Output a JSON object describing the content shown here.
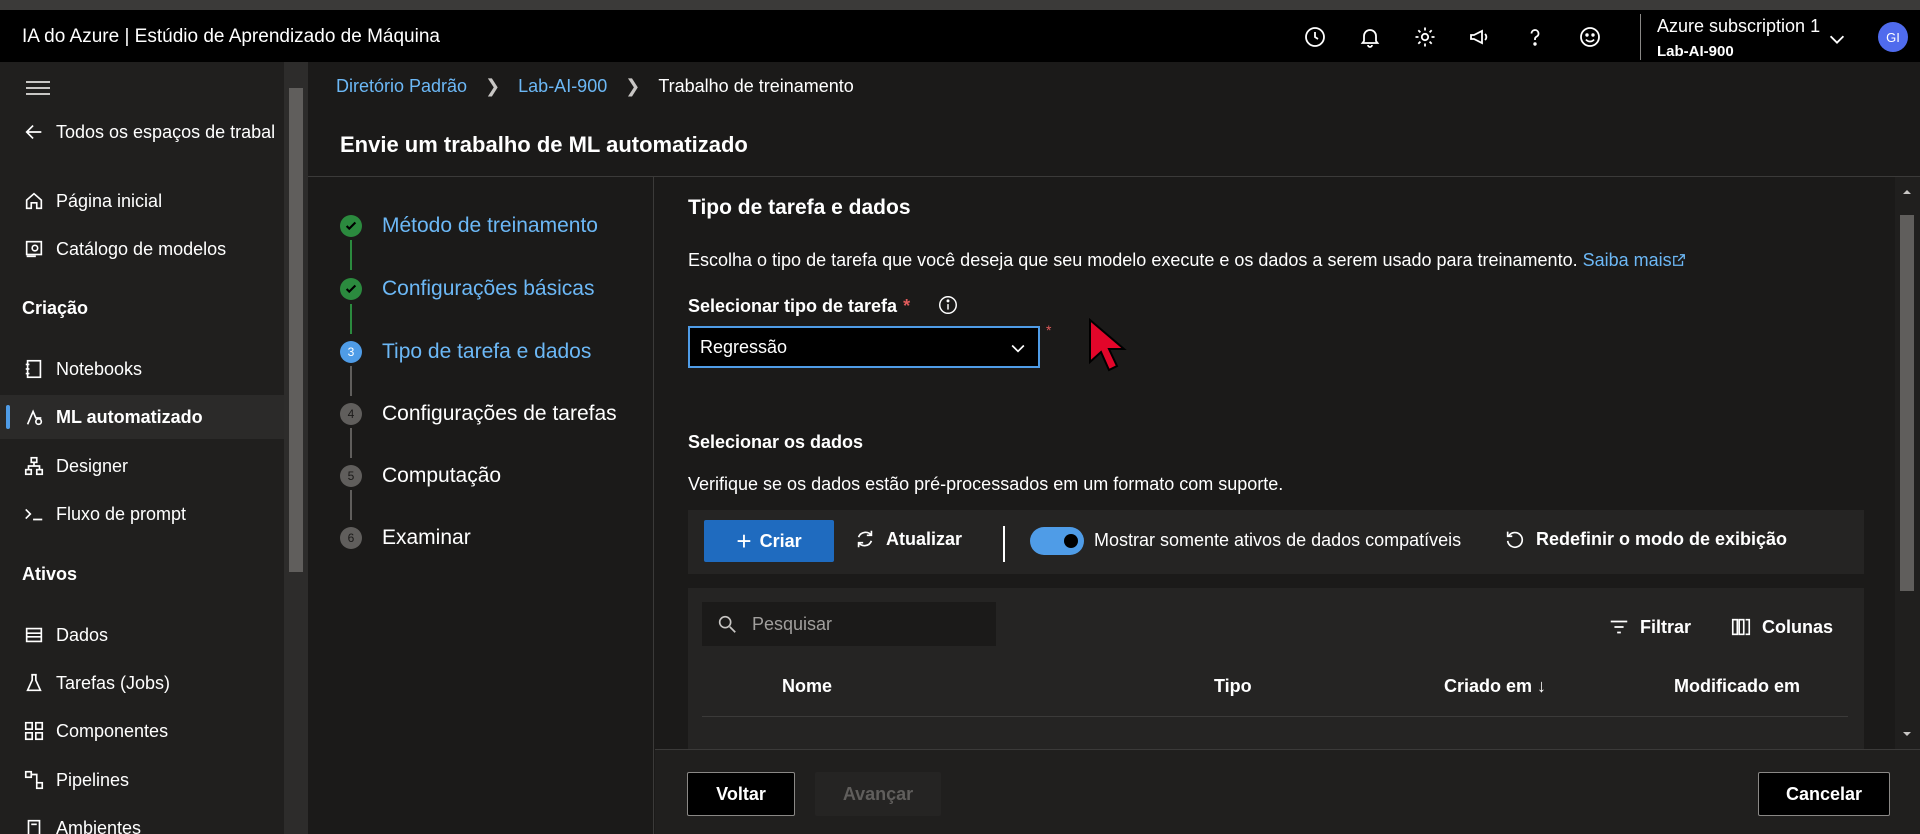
{
  "app": {
    "title": "IA do Azure | Estúdio de Aprendizado de Máquina",
    "subscription": "Azure subscription 1",
    "workspace": "Lab-AI-900",
    "user_initials": "GI"
  },
  "topbar_icons": [
    "clock-icon",
    "bell-icon",
    "gear-icon",
    "megaphone-icon",
    "help-icon",
    "smiley-icon"
  ],
  "sidebar": {
    "back_label": "Todos os espaços de trabal",
    "items_top": [
      {
        "label": "Página inicial",
        "icon": "home-icon"
      },
      {
        "label": "Catálogo de modelos",
        "icon": "catalog-icon"
      }
    ],
    "section_authoring": "Criação",
    "items_authoring": [
      {
        "label": "Notebooks",
        "icon": "notebook-icon"
      },
      {
        "label": "ML automatizado",
        "icon": "automl-icon",
        "active": true
      },
      {
        "label": "Designer",
        "icon": "designer-icon"
      },
      {
        "label": "Fluxo de prompt",
        "icon": "prompt-icon"
      }
    ],
    "section_assets": "Ativos",
    "items_assets": [
      {
        "label": "Dados",
        "icon": "data-icon"
      },
      {
        "label": "Tarefas (Jobs)",
        "icon": "flask-icon"
      },
      {
        "label": "Componentes",
        "icon": "components-icon"
      },
      {
        "label": "Pipelines",
        "icon": "pipelines-icon"
      },
      {
        "label": "Ambientes",
        "icon": "environments-icon"
      }
    ]
  },
  "breadcrumb": {
    "items": [
      "Diretório Padrão",
      "Lab-AI-900"
    ],
    "current": "Trabalho de treinamento"
  },
  "page_title": "Envie um trabalho de ML automatizado",
  "steps": [
    {
      "label": "Método de treinamento",
      "state": "done"
    },
    {
      "label": "Configurações básicas",
      "state": "done"
    },
    {
      "label": "Tipo de tarefa e dados",
      "state": "current",
      "number": "3"
    },
    {
      "label": "Configurações de tarefas",
      "state": "todo",
      "number": "4"
    },
    {
      "label": "Computação",
      "state": "todo",
      "number": "5"
    },
    {
      "label": "Examinar",
      "state": "todo",
      "number": "6"
    }
  ],
  "section": {
    "title": "Tipo de tarefa e dados",
    "description": "Escolha o tipo de tarefa que você deseja que seu modelo execute e os dados a serem usado para treinamento.",
    "learn_more": "Saiba mais",
    "task_label": "Selecionar tipo de tarefa",
    "required_mark": "*",
    "task_value": "Regressão",
    "data_title": "Selecionar os dados",
    "data_description": "Verifique se os dados estão pré-processados em um formato com suporte."
  },
  "toolbar": {
    "create": "Criar",
    "refresh": "Atualizar",
    "toggle_label": "Mostrar somente ativos de dados compatíveis",
    "toggle_on": true,
    "reset_view": "Redefinir o modo de exibição"
  },
  "table": {
    "search_placeholder": "Pesquisar",
    "filter": "Filtrar",
    "columns_btn": "Colunas",
    "headers": [
      "Nome",
      "Tipo",
      "Criado em ↓",
      "Modificado em"
    ]
  },
  "footer": {
    "back": "Voltar",
    "next": "Avançar",
    "cancel": "Cancelar"
  },
  "colors": {
    "accent": "#4f9ce7",
    "primary_button": "#1f6bbf",
    "success": "#2b8a3e",
    "required": "#e05b5b"
  }
}
